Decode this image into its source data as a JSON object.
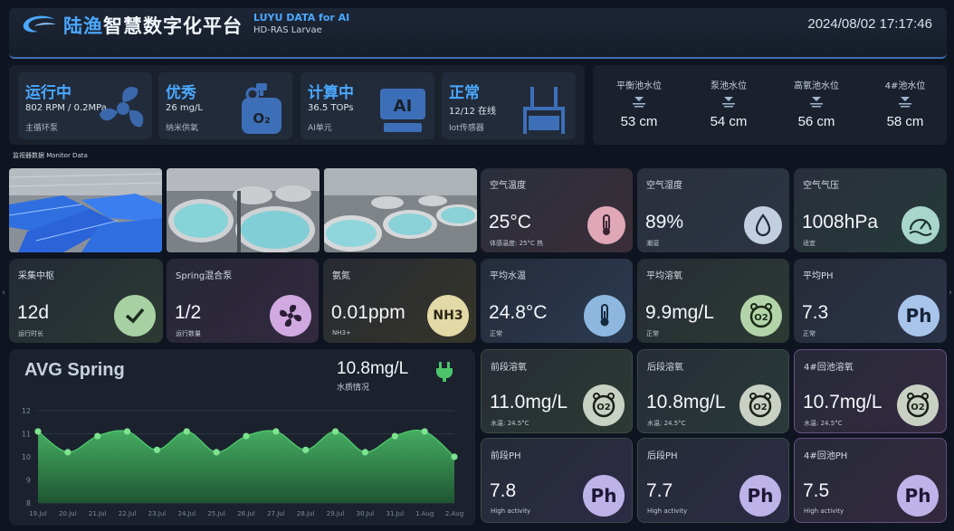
{
  "header": {
    "title_highlight": "陆渔",
    "title_rest": "智慧数字化平台",
    "subtitle_en": "LUYU DATA for AI",
    "subtitle_en2": "HD-RAS Larvae",
    "datetime": "2024/08/02  17:17:46"
  },
  "status_cards": [
    {
      "title": "运行中",
      "value": "802 RPM / 0.2MPa",
      "label": "主循环泵",
      "icon": "fan-icon"
    },
    {
      "title": "优秀",
      "value": "26 mg/L",
      "label": "纳米供氧",
      "icon": "oxygen-tank-icon"
    },
    {
      "title": "计算中",
      "value": "36.5 TOPs",
      "label": "AI单元",
      "icon": "ai-chip-icon"
    },
    {
      "title": "正常",
      "value": "12/12 在线",
      "label": "Iot传感器",
      "icon": "sensor-icon"
    }
  ],
  "water_levels": [
    {
      "label": "平衡池水位",
      "value": "53 cm"
    },
    {
      "label": "泵池水位",
      "value": "54 cm"
    },
    {
      "label": "高氧池水位",
      "value": "56 cm"
    },
    {
      "label": "4#池水位",
      "value": "58 cm"
    }
  ],
  "monitor_label": "监视器数据 Monitor Data",
  "metrics": {
    "air_temp": {
      "title": "空气温度",
      "value": "25°C",
      "sub": "体感温度: 25°C 热",
      "icon": "thermometer-icon"
    },
    "air_humidity": {
      "title": "空气湿度",
      "value": "89%",
      "sub": "潮湿",
      "icon": "droplet-icon"
    },
    "air_pressure": {
      "title": "空气气压",
      "value": "1008hPa",
      "sub": "适宜",
      "icon": "gauge-icon"
    },
    "collect": {
      "title": "采集中枢",
      "value": "12d",
      "sub": "运行时长",
      "icon": "check-icon"
    },
    "spring_pump": {
      "title": "Spring混合泵",
      "value": "1/2",
      "sub": "运行数量",
      "icon": "fan-icon"
    },
    "ammonia": {
      "title": "氨氮",
      "value": "0.01ppm",
      "sub": "NH3+",
      "icon_text": "NH3"
    },
    "avg_water_temp": {
      "title": "平均水温",
      "value": "24.8°C",
      "sub": "正常",
      "icon": "thermometer-icon"
    },
    "avg_do": {
      "title": "平均溶氧",
      "value": "9.9mg/L",
      "sub": "正常",
      "icon_text": "O2"
    },
    "avg_ph": {
      "title": "平均PH",
      "value": "7.3",
      "sub": "正常",
      "icon_text": "Ph"
    },
    "front_do": {
      "title": "前段溶氧",
      "value": "11.0mg/L",
      "sub": "水温: 24.5°C",
      "icon_text": "O2"
    },
    "rear_do": {
      "title": "后段溶氧",
      "value": "10.8mg/L",
      "sub": "水温: 24.5°C",
      "icon_text": "O2"
    },
    "pool4_do": {
      "title": "4#回池溶氧",
      "value": "10.7mg/L",
      "sub": "水温: 24.5°C",
      "icon_text": "O2"
    },
    "front_ph": {
      "title": "前段PH",
      "value": "7.8",
      "sub": "High activity",
      "icon_text": "Ph"
    },
    "rear_ph": {
      "title": "后段PH",
      "value": "7.7",
      "sub": "High activity",
      "icon_text": "Ph"
    },
    "pool4_ph": {
      "title": "4#回池PH",
      "value": "7.5",
      "sub": "High activity",
      "icon_text": "Ph"
    }
  },
  "chart_panel": {
    "title": "AVG Spring",
    "value": "10.8mg/L",
    "sub": "水质情况"
  },
  "chart_data": {
    "type": "area",
    "categories": [
      "19.Jul",
      "20.Jul",
      "21.Jul",
      "22.Jul",
      "23.Jul",
      "24.Jul",
      "25.Jul",
      "26.Jul",
      "27.Jul",
      "28.Jul",
      "29.Jul",
      "30.Jul",
      "31.Jul",
      "1.Aug",
      "2.Aug"
    ],
    "values": [
      11.1,
      10.2,
      10.9,
      11.1,
      10.3,
      11.1,
      10.2,
      10.9,
      11.1,
      10.3,
      11.1,
      10.2,
      10.9,
      11.1,
      10.0
    ],
    "yticks": [
      8,
      9,
      10,
      11,
      12
    ],
    "ylim": [
      8,
      12
    ],
    "color": "#4cc46a"
  },
  "colors": {
    "accent": "#4aa8ff",
    "chart_line": "#4cc46a"
  }
}
